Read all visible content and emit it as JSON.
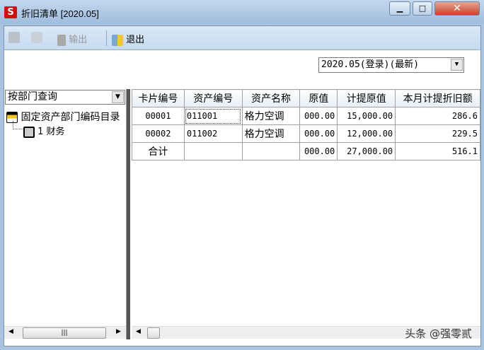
{
  "window": {
    "title": "折旧清单 [2020.05]",
    "logo": "S"
  },
  "toolbar": {
    "print": "print-icon",
    "preview": "preview-icon",
    "export_label": "输出",
    "exit_label": "退出"
  },
  "period_select": {
    "value": "2020.05(登录)(最新)"
  },
  "left": {
    "query_select": "按部门查询",
    "tree_root": "固定资产部门编码目录",
    "tree_child": "1 财务"
  },
  "table": {
    "headers": [
      "卡片编号",
      "资产编号",
      "资产名称",
      "原值",
      "计提原值",
      "本月计提折旧额"
    ],
    "rows": [
      [
        "00001",
        "011001",
        "格力空调",
        "000.00",
        "15,000.00",
        "286.6"
      ],
      [
        "00002",
        "011002",
        "格力空调",
        "000.00",
        "12,000.00",
        "229.5"
      ],
      [
        "合计",
        "",
        "",
        "000.00",
        "27,000.00",
        "516.1"
      ]
    ]
  },
  "watermark": "头条 @强零贰"
}
